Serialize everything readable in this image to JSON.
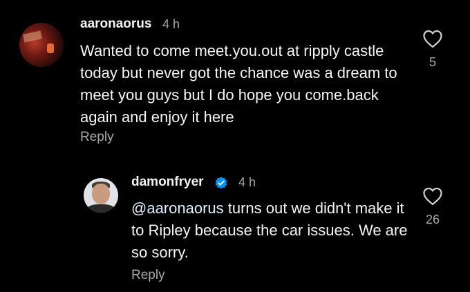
{
  "comments": [
    {
      "username": "aaronaorus",
      "time": "4 h",
      "text": "Wanted to come meet.you.out at ripply castle today but never got the chance was a dream to meet you guys but I do hope you come.back again and enjoy it here",
      "reply_label": "Reply",
      "like_count": "5",
      "icons": {
        "like": "heart-icon"
      }
    },
    {
      "username": "damonfryer",
      "verified": true,
      "time": "4 h",
      "mention": "@aaronaorus",
      "text": " turns out we didn't make it to Ripley because the car issues. We are so sorry.",
      "reply_label": "Reply",
      "like_count": "26",
      "icons": {
        "like": "heart-icon",
        "verified": "verified-badge-icon"
      }
    }
  ],
  "colors": {
    "background": "#000000",
    "text": "#f5f5f5",
    "secondary_text": "#a8a8a8",
    "verified_badge": "#0095f6"
  }
}
